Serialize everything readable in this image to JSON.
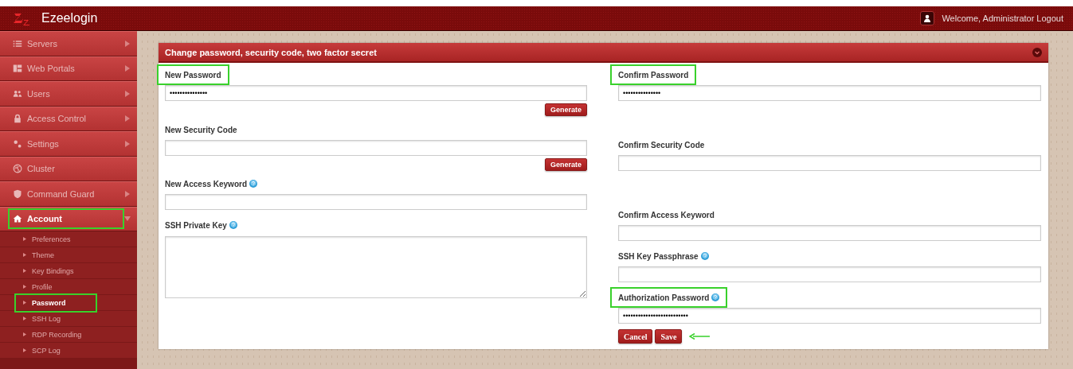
{
  "header": {
    "title": "Ezeelogin",
    "welcome": "Welcome, Administrator",
    "logout": "Logout"
  },
  "sidebar": {
    "items": [
      {
        "label": "Servers",
        "selected": false,
        "has_children": true,
        "highlighted": false
      },
      {
        "label": "Web Portals",
        "selected": false,
        "has_children": true,
        "highlighted": false
      },
      {
        "label": "Users",
        "selected": false,
        "has_children": true,
        "highlighted": false
      },
      {
        "label": "Access Control",
        "selected": false,
        "has_children": true,
        "highlighted": false
      },
      {
        "label": "Settings",
        "selected": false,
        "has_children": true,
        "highlighted": false
      },
      {
        "label": "Cluster",
        "selected": false,
        "has_children": false,
        "highlighted": false
      },
      {
        "label": "Command Guard",
        "selected": false,
        "has_children": true,
        "highlighted": false
      },
      {
        "label": "Account",
        "selected": true,
        "has_children": true,
        "highlighted": true,
        "children": [
          {
            "label": "Preferences",
            "selected": false,
            "highlighted": false
          },
          {
            "label": "Theme",
            "selected": false,
            "highlighted": false
          },
          {
            "label": "Key Bindings",
            "selected": false,
            "highlighted": false
          },
          {
            "label": "Profile",
            "selected": false,
            "highlighted": false
          },
          {
            "label": "Password",
            "selected": true,
            "highlighted": true
          },
          {
            "label": "SSH Log",
            "selected": false,
            "highlighted": false
          },
          {
            "label": "RDP Recording",
            "selected": false,
            "highlighted": false
          },
          {
            "label": "SCP Log",
            "selected": false,
            "highlighted": false
          }
        ]
      }
    ]
  },
  "panel": {
    "title": "Change password, security code, two factor secret",
    "left_fields": [
      {
        "label": "New Password",
        "kind": "input",
        "value": "•••••••••••••••",
        "help": false,
        "highlighted": true,
        "button": "Generate"
      },
      {
        "label": "New Security Code",
        "kind": "input",
        "help": false,
        "highlighted": false,
        "button": "Generate"
      },
      {
        "label": "New Access Keyword",
        "kind": "input",
        "help": true,
        "highlighted": false
      },
      {
        "label": "SSH Private Key",
        "kind": "textarea",
        "help": true,
        "highlighted": false
      }
    ],
    "right_fields": [
      {
        "label": "Confirm Password",
        "kind": "input",
        "value": "•••••••••••••••",
        "help": false,
        "highlighted": true
      },
      {
        "label": "Confirm Security Code",
        "kind": "input",
        "help": false,
        "highlighted": false
      },
      {
        "label": "Confirm Access Keyword",
        "kind": "input",
        "help": false,
        "highlighted": false
      },
      {
        "label": "SSH Key Passphrase",
        "kind": "input",
        "help": true,
        "highlighted": false
      },
      {
        "label": "Authorization Password",
        "kind": "input",
        "value": "••••••••••••••••••••••••••",
        "help": true,
        "highlighted": true
      }
    ],
    "buttons": [
      {
        "label": "Cancel",
        "pointed": false
      },
      {
        "label": "Save",
        "pointed": true
      }
    ]
  }
}
